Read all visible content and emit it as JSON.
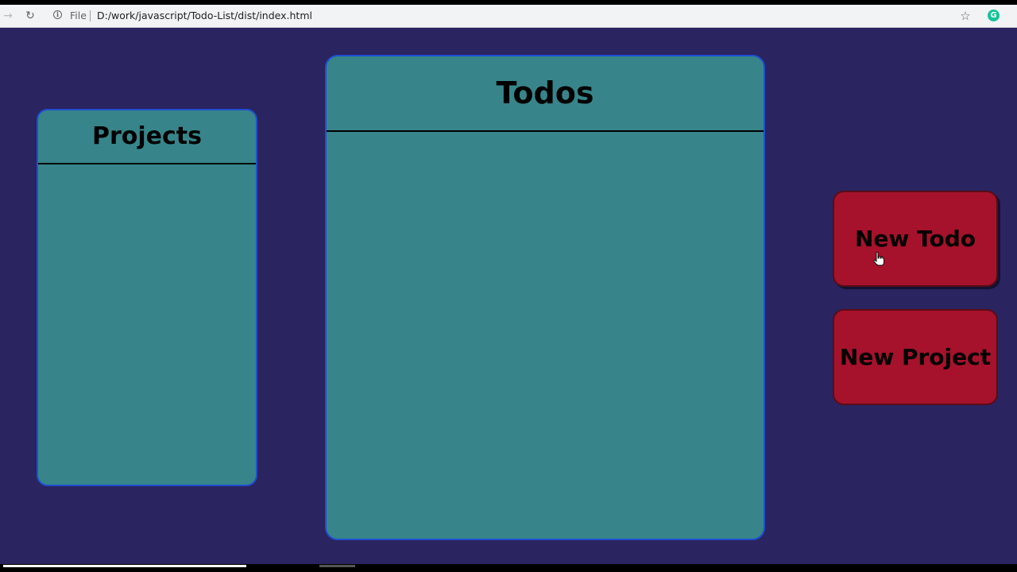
{
  "browser": {
    "forward_icon": "→",
    "reload_icon": "↻",
    "info_icon": "i",
    "scheme_label": "File",
    "url": "D:/work/javascript/Todo-List/dist/index.html",
    "bookmark_icon": "☆",
    "extension_icon": "G"
  },
  "projects": {
    "title": "Projects",
    "items": []
  },
  "todos": {
    "title": "Todos",
    "items": []
  },
  "actions": {
    "new_todo_label": "New Todo",
    "new_project_label": "New Project"
  },
  "colors": {
    "background": "#2a2460",
    "panel": "#37858a",
    "panel_border": "#1f4fd1",
    "button": "#a6122b"
  },
  "video_progress": 0.24
}
